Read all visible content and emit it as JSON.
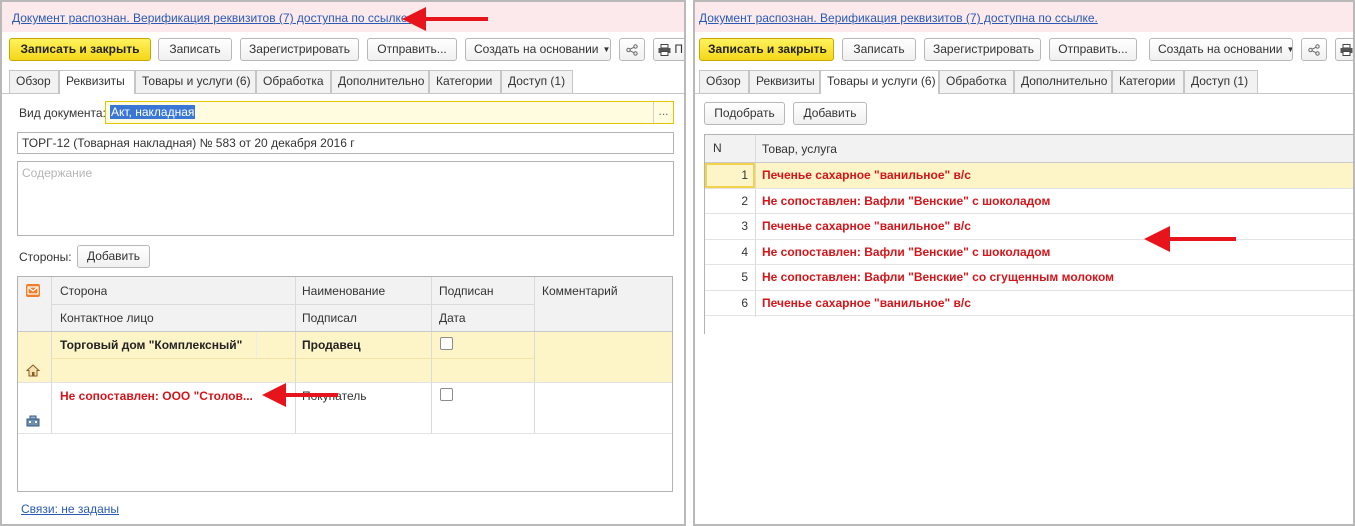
{
  "left": {
    "notification": "Документ распознан. Верификация реквизитов (7) доступна по ссылке.",
    "toolbar": {
      "write_close": "Записать и закрыть",
      "write": "Записать",
      "register": "Зарегистрировать",
      "send": "Отправить...",
      "create_based": "Создать на основании",
      "print_partial": "П"
    },
    "tabs": [
      "Обзор",
      "Реквизиты",
      "Товары и услуги (6)",
      "Обработка",
      "Дополнительно",
      "Категории",
      "Доступ (1)"
    ],
    "active_tab": "Реквизиты",
    "doc_type": {
      "label": "Вид документа:",
      "value": "Акт, накладная",
      "button": "..."
    },
    "title_field": "ТОРГ-12 (Товарная накладная) № 583 от 20 декабря 2016 г",
    "content_placeholder": "Содержание",
    "parties": {
      "label": "Стороны:",
      "add": "Добавить",
      "headers": {
        "side": "Сторона",
        "contact": "Контактное лицо",
        "name": "Наименование",
        "signed_by": "Подписал",
        "signed": "Подписан",
        "date": "Дата",
        "comment": "Комментарий"
      },
      "rows": [
        {
          "side": "Торговый дом \"Комплексный\"",
          "role": "Продавец",
          "signed": false
        },
        {
          "side": "Не сопоставлен: ООО \"Столов...",
          "role": "Покупатель",
          "signed": false
        }
      ]
    },
    "links": "Связи: не заданы"
  },
  "right": {
    "notification": "Документ распознан. Верификация реквизитов (7) доступна по ссылке.",
    "toolbar": {
      "write_close": "Записать и закрыть",
      "write": "Записать",
      "register": "Зарегистрировать",
      "send": "Отправить...",
      "create_based": "Создать на основании"
    },
    "tabs": [
      "Обзор",
      "Реквизиты",
      "Товары и услуги (6)",
      "Обработка",
      "Дополнительно",
      "Категории",
      "Доступ (1)"
    ],
    "active_tab": "Товары и услуги (6)",
    "actions": {
      "pick": "Подобрать",
      "add": "Добавить"
    },
    "goods": {
      "headers": {
        "n": "N",
        "item": "Товар, услуга"
      },
      "rows": [
        {
          "n": "1",
          "item": "Печенье сахарное \"ванильное\" в/с"
        },
        {
          "n": "2",
          "item": "Не сопоставлен: Вафли \"Венские\" с шоколадом"
        },
        {
          "n": "3",
          "item": "Печенье сахарное \"ванильное\" в/с"
        },
        {
          "n": "4",
          "item": "Не сопоставлен: Вафли \"Венские\" с шоколадом"
        },
        {
          "n": "5",
          "item": "Не сопоставлен: Вафли \"Венские\" со сгущенным молоком"
        },
        {
          "n": "6",
          "item": "Печенье сахарное \"ванильное\" в/с"
        }
      ]
    }
  },
  "colors": {
    "accent_yellow": "#f4d71a",
    "notification_bg": "#fbe9ec",
    "link_blue": "#2a5ab3",
    "error_red": "#d4161b",
    "arrow_red": "#e8141b",
    "selected_row": "#fdf4c7"
  }
}
